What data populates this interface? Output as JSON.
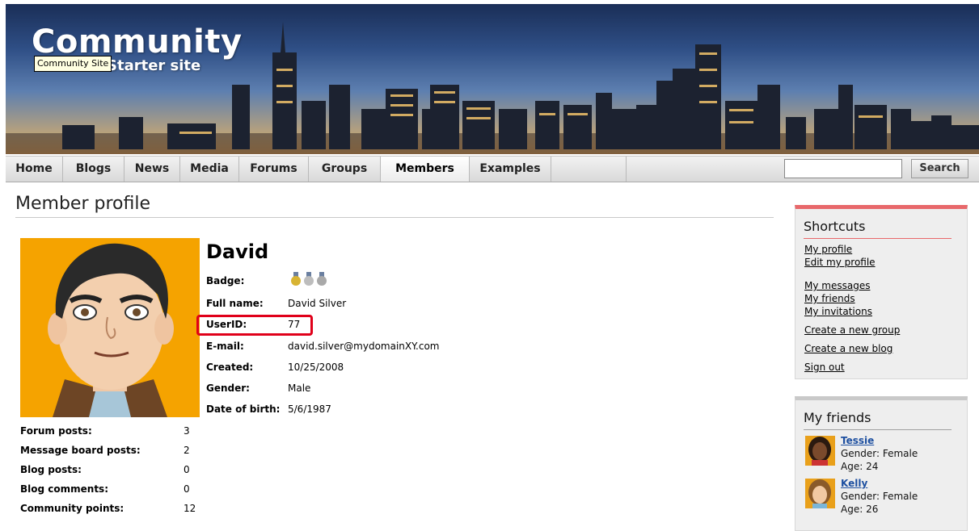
{
  "header": {
    "site_title": "Community",
    "site_subtitle": "Starter site",
    "tooltip": "Community Site"
  },
  "nav": {
    "items": [
      "Home",
      "Blogs",
      "News",
      "Media",
      "Forums",
      "Groups",
      "Members",
      "Examples"
    ],
    "active": "Members",
    "search_placeholder": "",
    "search_label": "Search"
  },
  "main": {
    "page_title": "Member profile",
    "member_name": "David",
    "badge_label": "Badge:",
    "fields": [
      {
        "label": "Full name:",
        "value": "David Silver"
      },
      {
        "label": "UserID:",
        "value": "77"
      },
      {
        "label": "E-mail:",
        "value": "david.silver@mydomainXY.com"
      },
      {
        "label": "Created:",
        "value": "10/25/2008"
      },
      {
        "label": "Gender:",
        "value": "Male"
      },
      {
        "label": "Date of birth:",
        "value": "5/6/1987"
      }
    ],
    "stats": [
      {
        "label": "Forum posts:",
        "value": "3"
      },
      {
        "label": "Message board posts:",
        "value": "2"
      },
      {
        "label": "Blog posts:",
        "value": "0"
      },
      {
        "label": "Blog comments:",
        "value": "0"
      },
      {
        "label": "Community points:",
        "value": "12"
      }
    ]
  },
  "shortcuts": {
    "title": "Shortcuts",
    "links": [
      "My profile",
      "Edit my profile",
      "My messages",
      "My friends",
      "My invitations",
      "Create a new group",
      "Create a new blog",
      "Sign out"
    ]
  },
  "friends": {
    "title": "My friends",
    "items": [
      {
        "name": "Tessie",
        "gender": "Gender: Female",
        "age": "Age: 24"
      },
      {
        "name": "Kelly",
        "gender": "Gender: Female",
        "age": "Age: 26"
      }
    ]
  },
  "colors": {
    "accent_red": "#e8686b",
    "highlight": "#e0001a",
    "avatar_bg": "#f5a300",
    "link_blue": "#1d4fa0"
  }
}
